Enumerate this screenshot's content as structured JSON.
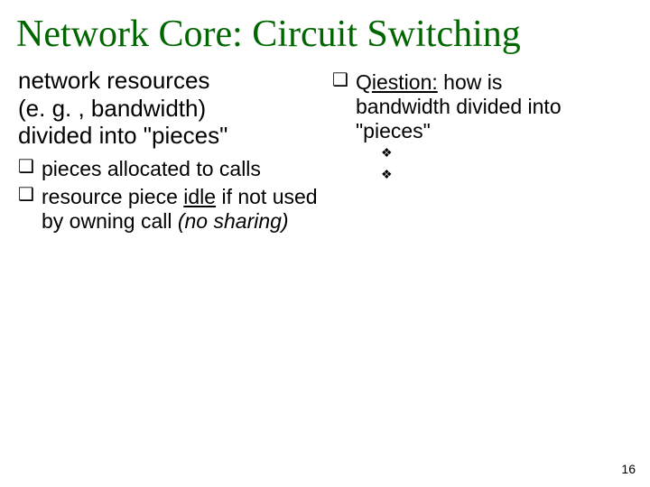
{
  "title": "Network Core: Circuit Switching",
  "left": {
    "lead_l1": "network resources",
    "lead_l2": "(e. g. , bandwidth)",
    "lead_l3": "divided into \"pieces\"",
    "b1": "pieces allocated to calls",
    "b2_prefix": "resource piece ",
    "b2_under": "idle",
    "b2_mid": " if not used by owning call ",
    "b2_ital": "(no sharing)"
  },
  "right": {
    "q_l1_pre": "Q",
    "q_l1_under": "iestion:",
    "q_l1_post": " how is",
    "q_l2": "bandwidth divided into",
    "q_l3": "\"pieces\"",
    "sub1": "",
    "sub2": ""
  },
  "page_number": "16"
}
